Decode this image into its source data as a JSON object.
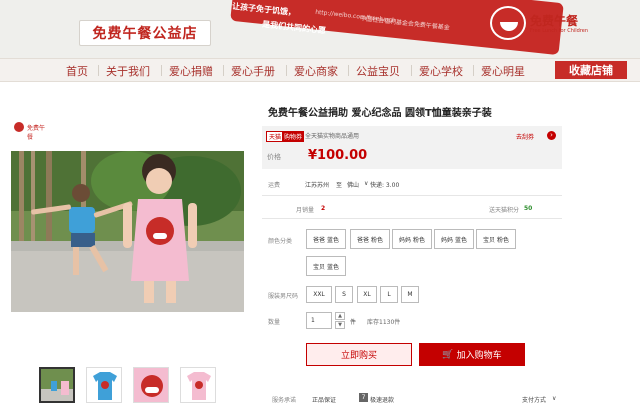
{
  "banner": {
    "shop_name": "免费午餐公益店",
    "ribbon_line1": "让孩子免于饥饿，",
    "ribbon_line2": "是我们共同的心愿",
    "ribbon_url": "http://weibo.com/freelunch",
    "ribbon_org": "中国社会福利基金会免费午餐基金",
    "brand_name": "免费午餐",
    "brand_sub": "Free Lunch for Children",
    "accent": "#c72c28"
  },
  "nav": {
    "items": [
      "首页",
      "关于我们",
      "爱心捐赠",
      "爱心手册",
      "爱心商家",
      "公益宝贝",
      "爱心学校",
      "爱心明星"
    ],
    "favorite": "收藏店铺"
  },
  "product": {
    "title": "免费午餐公益捐助 爱心纪念品 圆领T恤童装亲子装",
    "mini_logo_text": "免费午餐",
    "thumbnails": [
      "photo",
      "blue-tshirt",
      "red-logo",
      "pink-tshirt"
    ]
  },
  "price": {
    "tmall_tag": "天猫",
    "coupon_tag": "购物券",
    "coupon_text": "全天猫实物商品通用",
    "coupon_link": "去刮券",
    "label": "价格",
    "value": "¥100.00",
    "color": "#c40000"
  },
  "shipping": {
    "label": "运费",
    "from": "江苏苏州",
    "to_word": "至",
    "to": "佛山",
    "method": "快递: 3.00"
  },
  "stats": {
    "sales_label": "月销量",
    "sales_value": "2",
    "points_label": "送天猫积分",
    "points_value": "50"
  },
  "color_options": {
    "label": "颜色分类",
    "options": [
      "爸爸 蓝色",
      "爸爸 粉色",
      "妈妈 粉色",
      "妈妈 蓝色",
      "宝贝 粉色",
      "宝贝 蓝色"
    ]
  },
  "size_options": {
    "label": "服装男尺码",
    "options": [
      "XXL",
      "S",
      "XL",
      "L",
      "M"
    ]
  },
  "quantity": {
    "label": "数量",
    "value": "1",
    "unit": "件",
    "stock": "库存1130件"
  },
  "actions": {
    "buy_now": "立即购买",
    "add_cart": "加入购物车"
  },
  "service": {
    "label": "服务承诺",
    "items": [
      "正品保证",
      "极速退款"
    ],
    "icon_text": "7",
    "payment": "支付方式"
  }
}
